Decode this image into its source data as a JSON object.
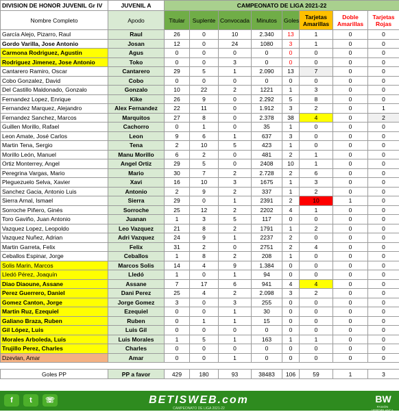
{
  "header": {
    "division": "DIVISION DE HONOR JUVENIL Gr IV",
    "team": "JUVENIL A",
    "campaign": "CAMPEONATO  DE LIGA 2021-22"
  },
  "columns": {
    "name": "Nombre Completo",
    "apodo": "Apodo",
    "titular": "Titular",
    "suplente": "Suplente",
    "convocada": "Convocada",
    "minutos": "Minutos",
    "goles": "Goles",
    "amarillas": "Tarjetas Amarillas",
    "doble": "Doble Amarillas",
    "rojas": "Tarjetas Rojas"
  },
  "players": [
    {
      "name": "García Alejo, Pizarro, Raul",
      "apodo": "Raul",
      "titular": "26",
      "suplente": "0",
      "convocada": "10",
      "minutos": "2.340",
      "goles": "13",
      "amarillas": "1",
      "doble": "0",
      "rojas": "0",
      "nameStyle": "",
      "bold": false,
      "golesStyle": "red-text",
      "amarillasStyle": ""
    },
    {
      "name": "Gordo Varilla, Jose Antonio",
      "apodo": "Josan",
      "titular": "12",
      "suplente": "0",
      "convocada": "24",
      "minutos": "1080",
      "goles": "3",
      "amarillas": "1",
      "doble": "0",
      "rojas": "0",
      "nameStyle": "",
      "bold": true,
      "golesStyle": "red-text",
      "amarillasStyle": ""
    },
    {
      "name": "Carmona Rodriguez, Agustin",
      "apodo": "Agus",
      "titular": "0",
      "suplente": "0",
      "convocada": "0",
      "minutos": "0",
      "goles": "0",
      "amarillas": "0",
      "doble": "0",
      "rojas": "0",
      "nameStyle": "yellow",
      "bold": true,
      "golesStyle": "red-text",
      "amarillasStyle": ""
    },
    {
      "name": "Rodriguez Jimenez, Jose Antonio",
      "apodo": "Toko",
      "titular": "0",
      "suplente": "0",
      "convocada": "3",
      "minutos": "0",
      "goles": "0",
      "amarillas": "0",
      "doble": "0",
      "rojas": "0",
      "nameStyle": "yellow",
      "bold": true,
      "golesStyle": "red-text",
      "amarillasStyle": ""
    },
    {
      "name": "Cantarero Ramiro, Oscar",
      "apodo": "Cantarero",
      "titular": "29",
      "suplente": "5",
      "convocada": "1",
      "minutos": "2.090",
      "goles": "13",
      "amarillas": "7",
      "doble": "0",
      "rojas": "0",
      "nameStyle": "",
      "bold": false,
      "golesStyle": "",
      "amarillasStyle": "lightgray"
    },
    {
      "name": "Cobo Gonzalez, David",
      "apodo": "Cobo",
      "titular": "0",
      "suplente": "0",
      "convocada": "0",
      "minutos": "0",
      "goles": "0",
      "amarillas": "0",
      "doble": "0",
      "rojas": "0",
      "nameStyle": "",
      "bold": false,
      "golesStyle": "",
      "amarillasStyle": ""
    },
    {
      "name": "Del Castillo Maldonado, Gonzalo",
      "apodo": "Gonzalo",
      "titular": "10",
      "suplente": "22",
      "convocada": "2",
      "minutos": "1221",
      "goles": "1",
      "amarillas": "3",
      "doble": "0",
      "rojas": "0",
      "nameStyle": "",
      "bold": false,
      "golesStyle": "",
      "amarillasStyle": ""
    },
    {
      "name": "Fernandez Lopez, Enrique",
      "apodo": "Kike",
      "titular": "26",
      "suplente": "9",
      "convocada": "0",
      "minutos": "2.292",
      "goles": "5",
      "amarillas": "8",
      "doble": "0",
      "rojas": "0",
      "nameStyle": "",
      "bold": false,
      "golesStyle": "",
      "amarillasStyle": ""
    },
    {
      "name": "Fernandez Marquez, Alejandro",
      "apodo": "Alex Fernandez",
      "titular": "22",
      "suplente": "11",
      "convocada": "0",
      "minutos": "1.912",
      "goles": "3",
      "amarillas": "2",
      "doble": "0",
      "rojas": "1",
      "nameStyle": "",
      "bold": false,
      "golesStyle": "",
      "amarillasStyle": ""
    },
    {
      "name": "Fernandez Sanchez, Marcos",
      "apodo": "Marquitos",
      "titular": "27",
      "suplente": "8",
      "convocada": "0",
      "minutos": "2.378",
      "goles": "38",
      "amarillas": "4",
      "doble": "0",
      "rojas": "2",
      "nameStyle": "",
      "bold": false,
      "golesStyle": "",
      "amarillasStyle": "yellow"
    },
    {
      "name": "Guillen Morillo, Rafael",
      "apodo": "Cachorro",
      "titular": "0",
      "suplente": "1",
      "convocada": "0",
      "minutos": "35",
      "goles": "1",
      "amarillas": "0",
      "doble": "0",
      "rojas": "0",
      "nameStyle": "",
      "bold": false,
      "golesStyle": "",
      "amarillasStyle": ""
    },
    {
      "name": "Leon Amate, José Carlos",
      "apodo": "Leon",
      "titular": "9",
      "suplente": "6",
      "convocada": "1",
      "minutos": "637",
      "goles": "3",
      "amarillas": "0",
      "doble": "0",
      "rojas": "0",
      "nameStyle": "",
      "bold": false,
      "golesStyle": "",
      "amarillasStyle": ""
    },
    {
      "name": "Martin Tena, Sergio",
      "apodo": "Tena",
      "titular": "2",
      "suplente": "10",
      "convocada": "5",
      "minutos": "423",
      "goles": "1",
      "amarillas": "0",
      "doble": "0",
      "rojas": "0",
      "nameStyle": "",
      "bold": false,
      "golesStyle": "",
      "amarillasStyle": ""
    },
    {
      "name": "Morillo León, Manuel",
      "apodo": "Manu Morillo",
      "titular": "6",
      "suplente": "2",
      "convocada": "0",
      "minutos": "481",
      "goles": "2",
      "amarillas": "1",
      "doble": "0",
      "rojas": "0",
      "nameStyle": "",
      "bold": false,
      "golesStyle": "",
      "amarillasStyle": ""
    },
    {
      "name": "Ortiz Monterrey, Angel",
      "apodo": "Angel Ortiz",
      "titular": "29",
      "suplente": "5",
      "convocada": "0",
      "minutos": "2408",
      "goles": "10",
      "amarillas": "1",
      "doble": "0",
      "rojas": "0",
      "nameStyle": "",
      "bold": false,
      "golesStyle": "",
      "amarillasStyle": ""
    },
    {
      "name": "Peregrina Vargas, Mario",
      "apodo": "Mario",
      "titular": "30",
      "suplente": "7",
      "convocada": "2",
      "minutos": "2.728",
      "goles": "2",
      "amarillas": "6",
      "doble": "0",
      "rojas": "0",
      "nameStyle": "",
      "bold": false,
      "golesStyle": "",
      "amarillasStyle": ""
    },
    {
      "name": "Pleguezuelo Selva, Xavier",
      "apodo": "Xavi",
      "titular": "16",
      "suplente": "10",
      "convocada": "3",
      "minutos": "1675",
      "goles": "1",
      "amarillas": "3",
      "doble": "0",
      "rojas": "0",
      "nameStyle": "",
      "bold": false,
      "golesStyle": "",
      "amarillasStyle": ""
    },
    {
      "name": "Sanchez Gacia, Antonio Luis",
      "apodo": "Antonio",
      "titular": "2",
      "suplente": "9",
      "convocada": "2",
      "minutos": "337",
      "goles": "1",
      "amarillas": "2",
      "doble": "0",
      "rojas": "0",
      "nameStyle": "",
      "bold": false,
      "golesStyle": "",
      "amarillasStyle": ""
    },
    {
      "name": "Sierra Arnal, Ismael",
      "apodo": "Sierra",
      "titular": "29",
      "suplente": "0",
      "convocada": "1",
      "minutos": "2391",
      "goles": "2",
      "amarillas": "10",
      "doble": "1",
      "rojas": "0",
      "nameStyle": "",
      "bold": false,
      "golesStyle": "",
      "amarillasStyle": "red-bg"
    },
    {
      "name": "Sorroche Piñero, Ginés",
      "apodo": "Sorroche",
      "titular": "25",
      "suplente": "12",
      "convocada": "2",
      "minutos": "2202",
      "goles": "4",
      "amarillas": "1",
      "doble": "0",
      "rojas": "0",
      "nameStyle": "",
      "bold": false,
      "golesStyle": "",
      "amarillasStyle": ""
    },
    {
      "name": "Toro Gaviño, Juan Antonio",
      "apodo": "Juanan",
      "titular": "1",
      "suplente": "3",
      "convocada": "5",
      "minutos": "117",
      "goles": "0",
      "amarillas": "0",
      "doble": "0",
      "rojas": "0",
      "nameStyle": "",
      "bold": false,
      "golesStyle": "",
      "amarillasStyle": ""
    },
    {
      "name": "Vazquez Lopez, Leopoldo",
      "apodo": "Leo Vazquez",
      "titular": "21",
      "suplente": "8",
      "convocada": "2",
      "minutos": "1791",
      "goles": "1",
      "amarillas": "2",
      "doble": "0",
      "rojas": "0",
      "nameStyle": "",
      "bold": false,
      "golesStyle": "",
      "amarillasStyle": ""
    },
    {
      "name": "Vazquez Nuñez, Adrian",
      "apodo": "Adri Vazquez",
      "titular": "24",
      "suplente": "9",
      "convocada": "1",
      "minutos": "2237",
      "goles": "2",
      "amarillas": "0",
      "doble": "0",
      "rojas": "0",
      "nameStyle": "",
      "bold": false,
      "golesStyle": "",
      "amarillasStyle": ""
    },
    {
      "name": "Martin Garreta, Felix",
      "apodo": "Felix",
      "titular": "31",
      "suplente": "2",
      "convocada": "0",
      "minutos": "2751",
      "goles": "2",
      "amarillas": "4",
      "doble": "0",
      "rojas": "0",
      "nameStyle": "",
      "bold": false,
      "golesStyle": "",
      "amarillasStyle": ""
    },
    {
      "name": "Ceballos Espinar, Jorge",
      "apodo": "Ceballos",
      "titular": "1",
      "suplente": "8",
      "convocada": "2",
      "minutos": "208",
      "goles": "1",
      "amarillas": "0",
      "doble": "0",
      "rojas": "0",
      "nameStyle": "",
      "bold": false,
      "golesStyle": "",
      "amarillasStyle": ""
    },
    {
      "name": "Solis Marin, Marcos",
      "apodo": "Marcos Solis",
      "titular": "14",
      "suplente": "4",
      "convocada": "9",
      "minutos": "1.384",
      "goles": "0",
      "amarillas": "0",
      "doble": "0",
      "rojas": "0",
      "nameStyle": "yellow",
      "bold": false,
      "golesStyle": "",
      "amarillasStyle": ""
    },
    {
      "name": "Lledó Pérez, Joaquín",
      "apodo": "Lledó",
      "titular": "1",
      "suplente": "0",
      "convocada": "1",
      "minutos": "94",
      "goles": "0",
      "amarillas": "0",
      "doble": "0",
      "rojas": "0",
      "nameStyle": "yellow",
      "bold": false,
      "golesStyle": "",
      "amarillasStyle": ""
    },
    {
      "name": "Diao Diaoune, Assane",
      "apodo": "Assane",
      "titular": "7",
      "suplente": "17",
      "convocada": "6",
      "minutos": "941",
      "goles": "4",
      "amarillas": "4",
      "doble": "0",
      "rojas": "0",
      "nameStyle": "yellow",
      "bold": true,
      "golesStyle": "",
      "amarillasStyle": "yellow"
    },
    {
      "name": "Perez Guerrero, Daniel",
      "apodo": "Dani Perez",
      "titular": "25",
      "suplente": "4",
      "convocada": "2",
      "minutos": "2.098",
      "goles": "3",
      "amarillas": "2",
      "doble": "0",
      "rojas": "0",
      "nameStyle": "yellow",
      "bold": true,
      "golesStyle": "",
      "amarillasStyle": ""
    },
    {
      "name": "Gomez Canton, Jorge",
      "apodo": "Jorge Gomez",
      "titular": "3",
      "suplente": "0",
      "convocada": "3",
      "minutos": "255",
      "goles": "0",
      "amarillas": "0",
      "doble": "0",
      "rojas": "0",
      "nameStyle": "yellow",
      "bold": true,
      "golesStyle": "",
      "amarillasStyle": ""
    },
    {
      "name": "Martin Ruz, Ezequiel",
      "apodo": "Ezequiel",
      "titular": "0",
      "suplente": "0",
      "convocada": "1",
      "minutos": "30",
      "goles": "0",
      "amarillas": "0",
      "doble": "0",
      "rojas": "0",
      "nameStyle": "yellow",
      "bold": true,
      "golesStyle": "",
      "amarillasStyle": ""
    },
    {
      "name": "Galiano Braza, Ruben",
      "apodo": "Ruben",
      "titular": "0",
      "suplente": "1",
      "convocada": "1",
      "minutos": "15",
      "goles": "0",
      "amarillas": "0",
      "doble": "0",
      "rojas": "0",
      "nameStyle": "yellow",
      "bold": true,
      "golesStyle": "",
      "amarillasStyle": ""
    },
    {
      "name": "Gil López, Luis",
      "apodo": "Luis Gil",
      "titular": "0",
      "suplente": "0",
      "convocada": "0",
      "minutos": "0",
      "goles": "0",
      "amarillas": "0",
      "doble": "0",
      "rojas": "0",
      "nameStyle": "yellow",
      "bold": true,
      "golesStyle": "",
      "amarillasStyle": ""
    },
    {
      "name": "Morales Arboleda, Luis",
      "apodo": "Luis Morales",
      "titular": "1",
      "suplente": "5",
      "convocada": "1",
      "minutos": "163",
      "goles": "1",
      "amarillas": "1",
      "doble": "0",
      "rojas": "0",
      "nameStyle": "yellow",
      "bold": true,
      "golesStyle": "",
      "amarillasStyle": ""
    },
    {
      "name": "Trujillo Perez, Charles",
      "apodo": "Charles",
      "titular": "0",
      "suplente": "0",
      "convocada": "0",
      "minutos": "0",
      "goles": "0",
      "amarillas": "0",
      "doble": "0",
      "rojas": "0",
      "nameStyle": "yellow",
      "bold": true,
      "golesStyle": "",
      "amarillasStyle": ""
    },
    {
      "name": "Dzevlan, Amar",
      "apodo": "Amar",
      "titular": "0",
      "suplente": "0",
      "convocada": "1",
      "minutos": "0",
      "goles": "0",
      "amarillas": "0",
      "doble": "0",
      "rojas": "0",
      "nameStyle": "orange",
      "bold": false,
      "golesStyle": "",
      "amarillasStyle": ""
    }
  ],
  "totals": {
    "label": "Goles PP",
    "apodo": "PP a favor",
    "titular": "429",
    "suplente": "180",
    "convocada": "93",
    "minutos": "38483",
    "goles": "106",
    "amarillas": "59",
    "doble": "1",
    "rojas": "3"
  },
  "footer": {
    "brand": "BETISWEB.com",
    "subtitle": "CAMPEONATO DE LIGA 2021-22",
    "logo": "BW",
    "logo_sub": "PASIÓN VERDIBLANCA",
    "icons": [
      "facebook-icon",
      "twitter-icon",
      "whatsapp-icon"
    ],
    "colors": {
      "green": "#2e8b1f",
      "header_green": "#70ad47",
      "yellow": "#ffff00",
      "red": "#ff0000",
      "orange": "#f4b183"
    }
  }
}
